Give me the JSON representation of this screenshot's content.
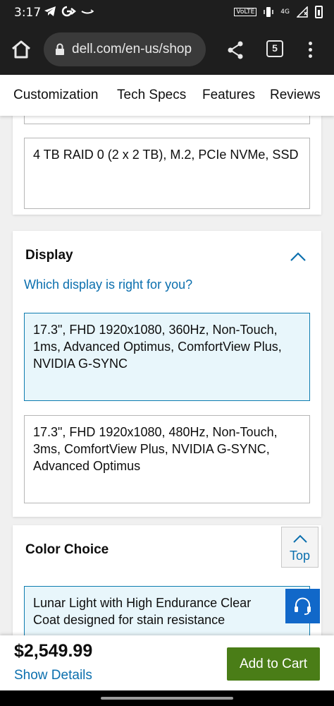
{
  "status_bar": {
    "time": "3:17",
    "icons": [
      "telegram-icon",
      "google-pay-icon",
      "amazon-icon"
    ],
    "network": "VoLTE",
    "signal": "4G"
  },
  "browser": {
    "url": "dell.com/en-us/shop",
    "tab_count": "5"
  },
  "nav": {
    "tabs": [
      "Customization",
      "Tech Specs",
      "Features",
      "Reviews"
    ]
  },
  "storage": {
    "option_text": "4 TB RAID 0 (2 x 2 TB), M.2, PCIe NVMe, SSD"
  },
  "display_section": {
    "title": "Display",
    "help_link": "Which display is right for you?",
    "options": [
      {
        "text": "17.3\", FHD 1920x1080, 360Hz, Non-Touch, 1ms, Advanced Optimus, ComfortView Plus, NVIDIA G-SYNC",
        "selected": true
      },
      {
        "text": "17.3\", FHD 1920x1080, 480Hz, Non-Touch, 3ms, ComfortView Plus, NVIDIA G-SYNC, Advanced Optimus",
        "selected": false
      }
    ]
  },
  "color_section": {
    "title": "Color Choice",
    "options": [
      {
        "text": "Lunar Light with High Endurance Clear Coat designed for stain resistance",
        "selected": true
      }
    ]
  },
  "top_button": {
    "label": "Top"
  },
  "price_bar": {
    "price": "$2,549.99",
    "details_link": "Show Details",
    "add_to_cart": "Add to Cart"
  },
  "colors": {
    "link_blue": "#0b6fae",
    "selected_bg": "#e8f6fb",
    "add_to_cart_green": "#4a7d17",
    "chat_blue": "#1168c9"
  }
}
